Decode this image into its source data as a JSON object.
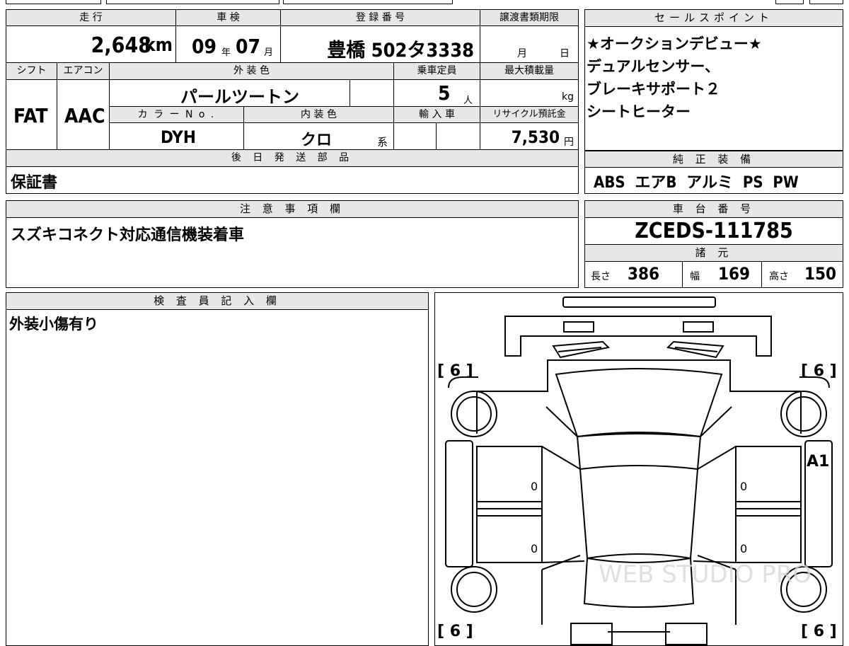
{
  "mileage": {
    "label": "走 行",
    "value": "2,648",
    "unit": "km"
  },
  "inspection": {
    "label": "車 検",
    "year": "09",
    "year_unit": "年",
    "month": "07",
    "month_unit": "月"
  },
  "registration": {
    "label": "登 録 番 号",
    "value": "豊橋 502タ3338"
  },
  "transfer_deadline": {
    "label": "譲渡書類期限",
    "month_unit": "月",
    "day_unit": "日"
  },
  "shift": {
    "label": "シフト",
    "value": "FAT"
  },
  "aircon": {
    "label": "エアコン",
    "value": "AAC"
  },
  "exterior_color": {
    "label": "外 装 色",
    "value": "パールツートン"
  },
  "capacity": {
    "label": "乗車定員",
    "value": "5",
    "unit": "人"
  },
  "max_load": {
    "label": "最大積載量",
    "unit": "kg"
  },
  "color_no": {
    "label": "カ ラ ー N o .",
    "value": "DYH"
  },
  "interior_color": {
    "label": "内 装 色",
    "value": "クロ",
    "unit": "系"
  },
  "import": {
    "label": "輸 入 車"
  },
  "recycle": {
    "label": "リサイクル預託金",
    "value": "7,530",
    "unit": "円"
  },
  "later_parts": {
    "label": "後 日 発 送 部 品",
    "value": "保証書"
  },
  "sales_points": {
    "label": "セールスポイント",
    "lines": [
      "★オークションデビュー★",
      "デュアルセンサー、",
      "ブレーキサポート２",
      "シートヒーター"
    ]
  },
  "equipment": {
    "label": "純 正 装 備",
    "value": "ABS  エアB  アルミ  PS  PW"
  },
  "notes": {
    "label": "注 意 事 項 欄",
    "value": "スズキコネクト対応通信機装着車"
  },
  "chassis": {
    "label": "車 台 番 号",
    "value": "ZCEDS-111785"
  },
  "specs": {
    "label": "諸 元",
    "length_label": "長さ",
    "length": "386",
    "width_label": "幅",
    "width": "169",
    "height_label": "高さ",
    "height": "150"
  },
  "inspector": {
    "label": "検 査 員 記 入 欄",
    "value": "外装小傷有り"
  },
  "diagram": {
    "tire_fl": "[ 6 ]",
    "tire_fr": "[ 6 ]",
    "tire_rl": "[ 6 ]",
    "tire_rr": "[ 6 ]",
    "mark_right": "A1",
    "zero": "0",
    "watermark": "WEB STUDIO PRO"
  }
}
